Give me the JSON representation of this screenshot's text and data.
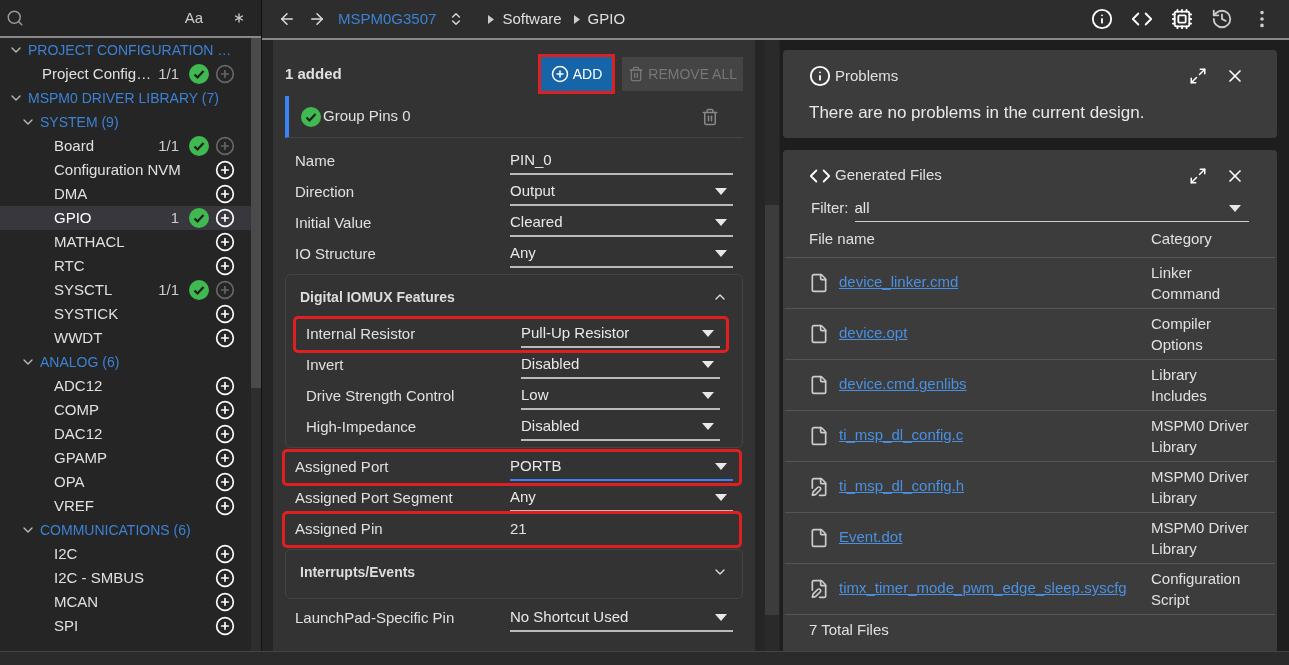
{
  "sidebar": {
    "case_toggle": "Aa",
    "tree": [
      {
        "label": "PROJECT CONFIGURATION …",
        "expanded": true,
        "children": [
          {
            "label": "Project Config…",
            "count": "1/1",
            "ok": true,
            "add_enabled": false,
            "selected": false
          }
        ]
      },
      {
        "label": "MSPM0 DRIVER LIBRARY (7)",
        "expanded": true,
        "children": [
          {
            "label": "SYSTEM (9)",
            "expanded": true,
            "children": [
              {
                "label": "Board",
                "count": "1/1",
                "ok": true,
                "add_enabled": false,
                "selected": false
              },
              {
                "label": "Configuration NVM",
                "ok": false,
                "add_enabled": true,
                "selected": false
              },
              {
                "label": "DMA",
                "ok": false,
                "add_enabled": true,
                "selected": false
              },
              {
                "label": "GPIO",
                "count": "1",
                "ok": true,
                "add_enabled": true,
                "selected": true
              },
              {
                "label": "MATHACL",
                "ok": false,
                "add_enabled": true,
                "selected": false
              },
              {
                "label": "RTC",
                "ok": false,
                "add_enabled": true,
                "selected": false
              },
              {
                "label": "SYSCTL",
                "count": "1/1",
                "ok": true,
                "add_enabled": false,
                "selected": false
              },
              {
                "label": "SYSTICK",
                "ok": false,
                "add_enabled": true,
                "selected": false
              },
              {
                "label": "WWDT",
                "ok": false,
                "add_enabled": true,
                "selected": false
              }
            ]
          },
          {
            "label": "ANALOG (6)",
            "expanded": true,
            "children": [
              {
                "label": "ADC12",
                "ok": false,
                "add_enabled": true,
                "selected": false
              },
              {
                "label": "COMP",
                "ok": false,
                "add_enabled": true,
                "selected": false
              },
              {
                "label": "DAC12",
                "ok": false,
                "add_enabled": true,
                "selected": false
              },
              {
                "label": "GPAMP",
                "ok": false,
                "add_enabled": true,
                "selected": false
              },
              {
                "label": "OPA",
                "ok": false,
                "add_enabled": true,
                "selected": false
              },
              {
                "label": "VREF",
                "ok": false,
                "add_enabled": true,
                "selected": false
              }
            ]
          },
          {
            "label": "COMMUNICATIONS (6)",
            "expanded": true,
            "children": [
              {
                "label": "I2C",
                "ok": false,
                "add_enabled": true,
                "selected": false
              },
              {
                "label": "I2C - SMBUS",
                "ok": false,
                "add_enabled": true,
                "selected": false
              },
              {
                "label": "MCAN",
                "ok": false,
                "add_enabled": true,
                "selected": false
              },
              {
                "label": "SPI",
                "ok": false,
                "add_enabled": true,
                "selected": false
              }
            ]
          }
        ]
      }
    ]
  },
  "breadcrumb": {
    "device": "MSPM0G3507",
    "path": [
      "Software",
      "GPIO"
    ]
  },
  "module": {
    "added": "1 added",
    "add_button": {
      "label": "ADD",
      "highlighted": true
    },
    "remove_all": {
      "label": "REMOVE ALL",
      "disabled": true
    },
    "instance": {
      "name": "Group Pins 0",
      "ok": true
    },
    "items": [
      {
        "kind": "text",
        "label": "Name",
        "value": "PIN_0",
        "highlighted": false
      },
      {
        "kind": "select",
        "label": "Direction",
        "value": "Output",
        "highlighted": false
      },
      {
        "kind": "select",
        "label": "Initial Value",
        "value": "Cleared",
        "highlighted": false
      },
      {
        "kind": "select",
        "label": "IO Structure",
        "value": "Any",
        "highlighted": false
      },
      {
        "kind": "section",
        "title": "Digital IOMUX Features",
        "expanded": true,
        "fields": [
          {
            "kind": "select",
            "label": "Internal Resistor",
            "value": "Pull-Up Resistor",
            "highlighted": true
          },
          {
            "kind": "select",
            "label": "Invert",
            "value": "Disabled",
            "highlighted": false
          },
          {
            "kind": "select",
            "label": "Drive Strength Control",
            "value": "Low",
            "highlighted": false
          },
          {
            "kind": "select",
            "label": "High-Impedance",
            "value": "Disabled",
            "highlighted": false
          }
        ]
      },
      {
        "kind": "select",
        "label": "Assigned Port",
        "value": "PORTB",
        "highlighted": true,
        "focused": true
      },
      {
        "kind": "select",
        "label": "Assigned Port Segment",
        "value": "Any",
        "highlighted": false
      },
      {
        "kind": "static",
        "label": "Assigned Pin",
        "value": "21",
        "highlighted": true
      },
      {
        "kind": "section",
        "title": "Interrupts/Events",
        "expanded": false
      },
      {
        "kind": "select",
        "label": "LaunchPad-Specific Pin",
        "value": "No Shortcut Used",
        "highlighted": false
      }
    ]
  },
  "problems": {
    "title": "Problems",
    "message": "There are no problems in the current design."
  },
  "generated_files": {
    "title": "Generated Files",
    "filter_label": "Filter:",
    "filter_value": "all",
    "columns": [
      "File name",
      "Category"
    ],
    "rows": [
      {
        "name": "device_linker.cmd",
        "category": "Linker Command",
        "kind": "file"
      },
      {
        "name": "device.opt",
        "category": "Compiler Options",
        "kind": "file"
      },
      {
        "name": "device.cmd.genlibs",
        "category": "Library Includes",
        "kind": "file"
      },
      {
        "name": "ti_msp_dl_config.c",
        "category": "MSPM0 Driver Library",
        "kind": "file"
      },
      {
        "name": "ti_msp_dl_config.h",
        "category": "MSPM0 Driver Library",
        "kind": "edited"
      },
      {
        "name": "Event.dot",
        "category": "MSPM0 Driver Library",
        "kind": "file"
      },
      {
        "name": "timx_timer_mode_pwm_edge_sleep.syscfg",
        "category": "Configuration Script",
        "kind": "edited"
      }
    ],
    "total": "7 Total Files"
  }
}
